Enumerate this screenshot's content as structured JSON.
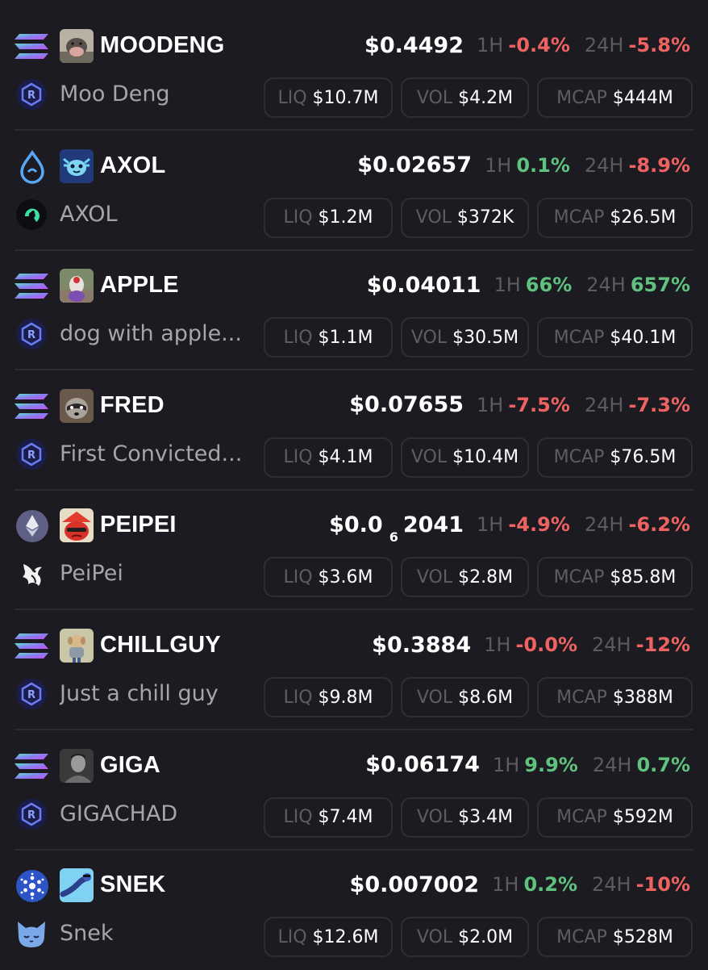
{
  "labels": {
    "h1": "1H",
    "h24": "24H",
    "liq": "LIQ",
    "vol": "VOL",
    "mcap": "MCAP"
  },
  "colors": {
    "up": "#5fc27e",
    "down": "#ee6361",
    "background": "#1c1b21"
  },
  "tokens": [
    {
      "symbol": "MOODENG",
      "name": "Moo Deng",
      "chain_icon": "solana-icon",
      "dex_icon": "raydium-icon",
      "avatar_icon": "moodeng-avatar-icon",
      "price": "$0.4492",
      "h1": "-0.4%",
      "h1_dir": "down",
      "h24": "-5.8%",
      "h24_dir": "down",
      "liq": "$10.7M",
      "vol": "$4.2M",
      "mcap": "$444M"
    },
    {
      "symbol": "AXOL",
      "name": "AXOL",
      "chain_icon": "sui-icon",
      "dex_icon": "cetus-icon",
      "avatar_icon": "axol-avatar-icon",
      "price": "$0.02657",
      "h1": "0.1%",
      "h1_dir": "up",
      "h24": "-8.9%",
      "h24_dir": "down",
      "liq": "$1.2M",
      "vol": "$372K",
      "mcap": "$26.5M"
    },
    {
      "symbol": "APPLE",
      "name": "dog with apple...",
      "chain_icon": "solana-icon",
      "dex_icon": "raydium-icon",
      "avatar_icon": "apple-avatar-icon",
      "price": "$0.04011",
      "h1": "66%",
      "h1_dir": "up",
      "h24": "657%",
      "h24_dir": "up",
      "liq": "$1.1M",
      "vol": "$30.5M",
      "mcap": "$40.1M"
    },
    {
      "symbol": "FRED",
      "name": "First Convicted...",
      "chain_icon": "solana-icon",
      "dex_icon": "raydium-icon",
      "avatar_icon": "fred-avatar-icon",
      "price": "$0.07655",
      "h1": "-7.5%",
      "h1_dir": "down",
      "h24": "-7.3%",
      "h24_dir": "down",
      "liq": "$4.1M",
      "vol": "$10.4M",
      "mcap": "$76.5M"
    },
    {
      "symbol": "PEIPEI",
      "name": "PeiPei",
      "chain_icon": "ethereum-icon",
      "dex_icon": "uniswap-icon",
      "avatar_icon": "peipei-avatar-icon",
      "price": "$0.0",
      "price_sub": "6",
      "price_tail": "2041",
      "h1": "-4.9%",
      "h1_dir": "down",
      "h24": "-6.2%",
      "h24_dir": "down",
      "liq": "$3.6M",
      "vol": "$2.8M",
      "mcap": "$85.8M"
    },
    {
      "symbol": "CHILLGUY",
      "name": "Just a chill guy",
      "chain_icon": "solana-icon",
      "dex_icon": "raydium-icon",
      "avatar_icon": "chillguy-avatar-icon",
      "price": "$0.3884",
      "h1": "-0.0%",
      "h1_dir": "down",
      "h24": "-12%",
      "h24_dir": "down",
      "liq": "$9.8M",
      "vol": "$8.6M",
      "mcap": "$388M"
    },
    {
      "symbol": "GIGA",
      "name": "GIGACHAD",
      "chain_icon": "solana-icon",
      "dex_icon": "raydium-icon",
      "avatar_icon": "giga-avatar-icon",
      "price": "$0.06174",
      "h1": "9.9%",
      "h1_dir": "up",
      "h24": "0.7%",
      "h24_dir": "up",
      "liq": "$7.4M",
      "vol": "$3.4M",
      "mcap": "$592M"
    },
    {
      "symbol": "SNEK",
      "name": "Snek",
      "chain_icon": "cardano-icon",
      "dex_icon": "snek-cat-icon",
      "avatar_icon": "snek-avatar-icon",
      "price": "$0.007002",
      "h1": "0.2%",
      "h1_dir": "up",
      "h24": "-10%",
      "h24_dir": "down",
      "liq": "$12.6M",
      "vol": "$2.0M",
      "mcap": "$528M"
    }
  ]
}
